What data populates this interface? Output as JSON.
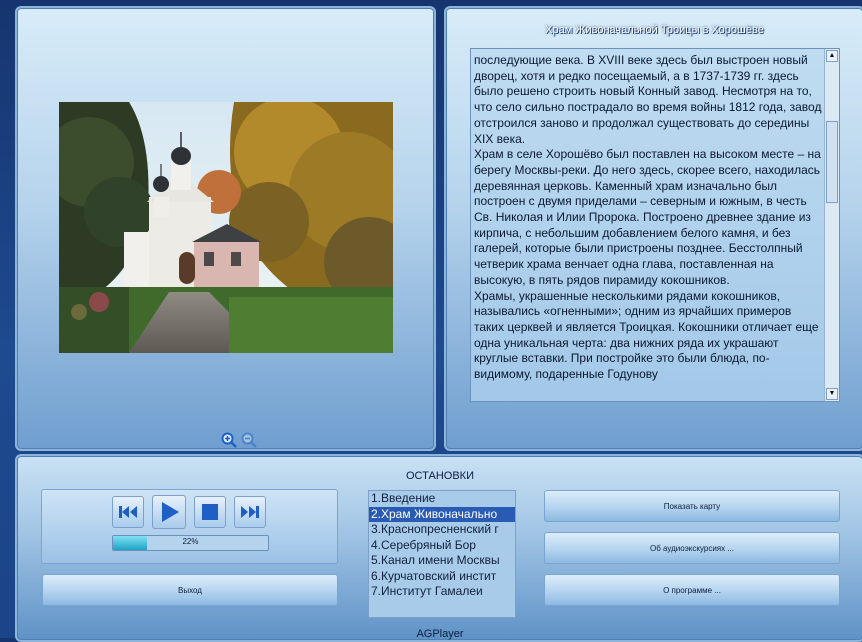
{
  "article": {
    "title": "Храм Живоначальной Троицы в Хорошёве",
    "text": "последующие века. В XVIII веке здесь был выстроен новый дворец, хотя и редко посещаемый, а в 1737-1739 гг. здесь было решено строить новый Конный завод. Несмотря на то, что село сильно пострадало во время войны 1812 года, завод отстроился заново и продолжал существовать до середины XIX века.\nХрам в селе Хорошёво был поставлен на высоком месте – на берегу Москвы-реки. До него здесь, скорее всего, находилась деревянная церковь. Каменный храм изначально был построен с двумя приделами – северным и южным, в честь Св. Николая и Илии Пророка. Построено древнее здание из кирпича, с небольшим добавлением белого камня, и без галерей, которые были пристроены позднее. Бесстолпный четверик храма венчает одна глава, поставленная на высокую, в пять рядов пирамиду кокошников.\nХрамы, украшенные несколькими рядами кокошников, назывались «огненными»; одним из ярчайших примеров таких церквей и является Троицкая. Кокошники отличает еще одна уникальная черта: два нижних ряда их украшают круглые вставки. При постройке это были блюда, по-видимому, подаренные Годунову"
  },
  "stops": {
    "label": "ОСТАНОВКИ",
    "selected_index": 1,
    "items": [
      "1.Введение",
      "2.Храм Живоначально",
      "3.Краснопресненский г",
      "4.Серебряный Бор",
      "5.Канал имени Москвы",
      "6.Курчатовский инстит",
      "7.Институт Гамалеи"
    ]
  },
  "player": {
    "progress_percent": 22,
    "progress_label": "22%"
  },
  "buttons": {
    "exit": "Выход",
    "show_map": "Показать карту",
    "about_tour": "Об аудиоэкскурсиях ...",
    "about_program": "О программе ..."
  },
  "app_name": "AGPlayer",
  "icons": {
    "prev": "skip-back-icon",
    "play": "play-icon",
    "stop": "stop-icon",
    "next": "skip-forward-icon",
    "zoom_in": "zoom-in-icon",
    "zoom_out": "zoom-out-icon"
  },
  "colors": {
    "accent": "#1d5fc4",
    "selection": "#2a5bb4",
    "progress": "#1fa3c7"
  }
}
